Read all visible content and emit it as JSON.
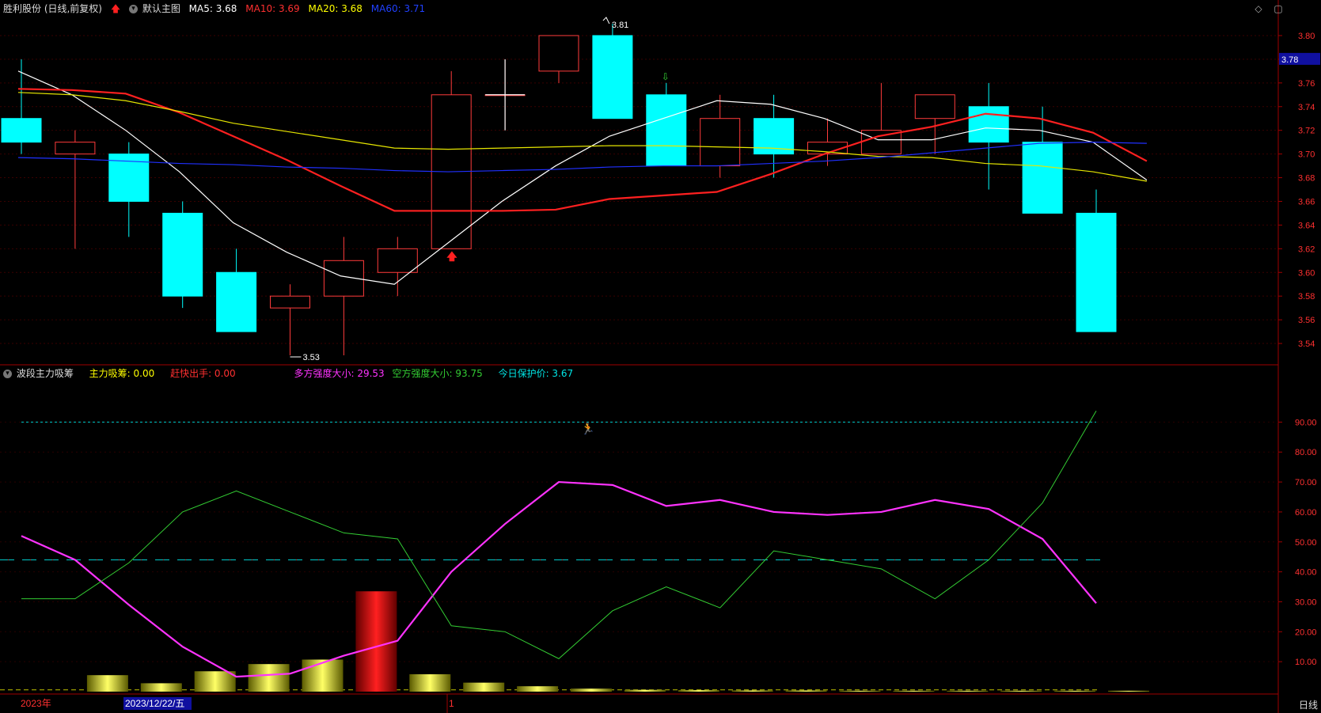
{
  "header": {
    "title": "胜利股份 (日线,前复权)",
    "main_chart_label": "默认主图",
    "ma5_label": "MA5: 3.68",
    "ma10_label": "MA10: 3.69",
    "ma20_label": "MA20: 3.68",
    "ma60_label": "MA60: 3.71"
  },
  "indicator": {
    "name": "波段主力吸筹",
    "main_absorb": "主力吸筹: 0.00",
    "quick_exit": "赶快出手: 0.00",
    "bull_strength": "多方强度大小: 29.53",
    "bear_strength": "空方强度大小: 93.75",
    "protect_price": "今日保护价: 3.67"
  },
  "price_axis": {
    "ticks": [
      "3.80",
      "3.78",
      "3.76",
      "3.74",
      "3.72",
      "3.70",
      "3.68",
      "3.66",
      "3.64",
      "3.62",
      "3.60",
      "3.58",
      "3.56",
      "3.54"
    ],
    "current_price_label": "3.78"
  },
  "ind_axis": {
    "ticks": [
      "90.00",
      "80.00",
      "70.00",
      "60.00",
      "50.00",
      "40.00",
      "30.00",
      "20.00",
      "10.00"
    ]
  },
  "time_axis": {
    "labels": [
      "2023年",
      "2023/12/22/五",
      "1"
    ]
  },
  "annotations": {
    "high": "3.81",
    "low": "3.53"
  },
  "period": "日线",
  "colors": {
    "up": "#ff3b3b",
    "down": "#00ffff",
    "ma5": "#ffffff",
    "ma10": "#ff2020",
    "ma20": "#e6e600",
    "ma60": "#2030ff",
    "bull": "#ff33ff",
    "bear": "#33cc33",
    "grid": "#7a0000",
    "ref": "#00cccc"
  },
  "chart_data": [
    {
      "type": "candlestick",
      "title": "胜利股份 (日线,前复权)",
      "ylim": [
        3.53,
        3.81
      ],
      "ohlc": [
        [
          3.73,
          3.78,
          3.7,
          3.71
        ],
        [
          3.7,
          3.72,
          3.62,
          3.71
        ],
        [
          3.7,
          3.71,
          3.63,
          3.66
        ],
        [
          3.65,
          3.66,
          3.57,
          3.58
        ],
        [
          3.6,
          3.62,
          3.55,
          3.55
        ],
        [
          3.57,
          3.59,
          3.53,
          3.58
        ],
        [
          3.58,
          3.63,
          3.53,
          3.61
        ],
        [
          3.6,
          3.63,
          3.58,
          3.62
        ],
        [
          3.62,
          3.77,
          3.62,
          3.75
        ],
        [
          3.75,
          3.78,
          3.72,
          3.75
        ],
        [
          3.77,
          3.8,
          3.76,
          3.8
        ],
        [
          3.8,
          3.81,
          3.73,
          3.73
        ],
        [
          3.75,
          3.76,
          3.69,
          3.69
        ],
        [
          3.69,
          3.75,
          3.68,
          3.73
        ],
        [
          3.73,
          3.75,
          3.68,
          3.7
        ],
        [
          3.7,
          3.73,
          3.69,
          3.71
        ],
        [
          3.7,
          3.76,
          3.7,
          3.72
        ],
        [
          3.73,
          3.75,
          3.7,
          3.75
        ],
        [
          3.74,
          3.76,
          3.67,
          3.71
        ],
        [
          3.71,
          3.74,
          3.65,
          3.65
        ],
        [
          3.65,
          3.67,
          3.55,
          3.55
        ]
      ],
      "series": [
        {
          "name": "MA5",
          "values": [
            3.77,
            3.75,
            3.72,
            3.685,
            3.642,
            3.617,
            3.597,
            3.59,
            3.625,
            3.66,
            3.69,
            3.715,
            3.73,
            3.745,
            3.742,
            3.73,
            3.712,
            3.712,
            3.722,
            3.72,
            3.71,
            3.678
          ]
        },
        {
          "name": "MA10",
          "values": [
            3.755,
            3.754,
            3.751,
            3.735,
            3.715,
            3.695,
            3.673,
            3.652,
            3.652,
            3.652,
            3.653,
            3.662,
            3.665,
            3.668,
            3.683,
            3.7,
            3.715,
            3.723,
            3.734,
            3.73,
            3.718,
            3.694
          ]
        },
        {
          "name": "MA20",
          "values": [
            3.752,
            3.75,
            3.745,
            3.736,
            3.726,
            3.719,
            3.712,
            3.705,
            3.704,
            3.705,
            3.706,
            3.707,
            3.707,
            3.706,
            3.705,
            3.702,
            3.698,
            3.697,
            3.692,
            3.69,
            3.685,
            3.677
          ]
        },
        {
          "name": "MA60",
          "values": [
            3.697,
            3.696,
            3.694,
            3.692,
            3.691,
            3.689,
            3.688,
            3.686,
            3.685,
            3.686,
            3.687,
            3.689,
            3.69,
            3.69,
            3.692,
            3.694,
            3.697,
            3.701,
            3.705,
            3.709,
            3.71,
            3.709
          ]
        }
      ]
    },
    {
      "type": "bar",
      "title": "波段主力吸筹",
      "ylim": [
        0,
        100
      ],
      "values": [
        0.5,
        5.5,
        2.8,
        6.8,
        9.2,
        10.7,
        33.5,
        5.8,
        3.0,
        1.8,
        1.0,
        0.6,
        0.5,
        0.4,
        0.4,
        0.3,
        0.3,
        0.3,
        0.3,
        0.3,
        0.3
      ],
      "series": [
        {
          "name": "多方强度大小",
          "values": [
            52,
            44,
            29,
            15,
            5,
            6,
            12,
            17,
            40,
            56,
            70,
            69,
            62,
            64,
            60,
            59,
            60,
            64,
            61,
            51,
            29.53
          ]
        },
        {
          "name": "空方强度大小",
          "values": [
            31,
            31,
            43,
            60,
            67,
            60,
            53,
            51,
            22,
            20,
            11,
            27,
            35,
            28,
            47,
            44,
            41,
            31,
            44,
            63,
            93.75
          ]
        }
      ],
      "reference_lines": [
        90,
        44
      ]
    }
  ]
}
